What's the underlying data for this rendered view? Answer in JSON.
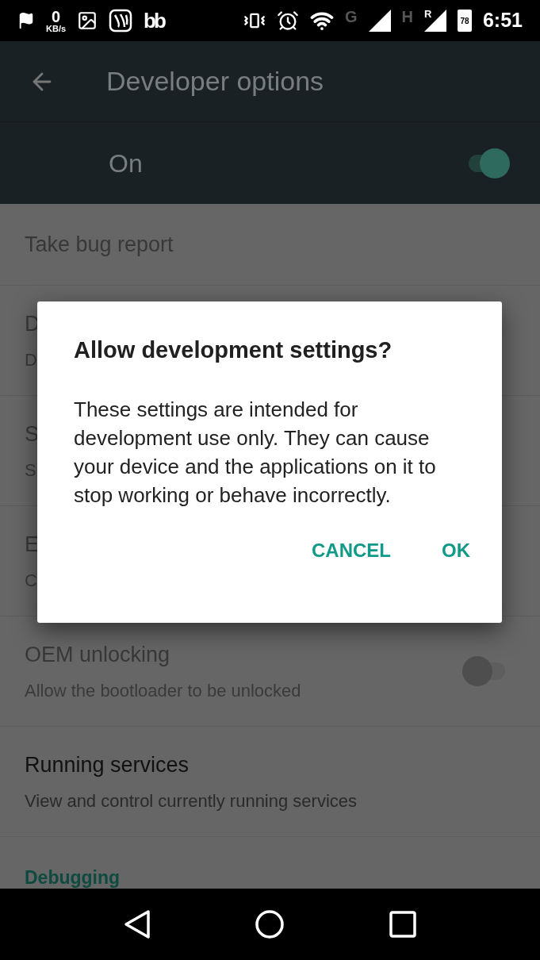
{
  "status_bar": {
    "net_speed": "0",
    "net_unit": "KB/s",
    "app_logo": "bb",
    "network_1": "G",
    "network_2": "H",
    "roaming": "R",
    "battery": "78",
    "time": "6:51"
  },
  "toolbar": {
    "title": "Developer options"
  },
  "master_switch": {
    "label": "On",
    "on": true
  },
  "rows": [
    {
      "title": "Take bug report",
      "disabled": true
    },
    {
      "title": "D",
      "subtitle": "D",
      "disabled": true
    },
    {
      "title": "S",
      "subtitle": "S",
      "disabled": true
    },
    {
      "title": "E",
      "subtitle": "C",
      "disabled": true
    },
    {
      "title": "OEM unlocking",
      "subtitle": "Allow the bootloader to be unlocked",
      "disabled": true,
      "toggle": {
        "on": false
      }
    },
    {
      "title": "Running services",
      "subtitle": "View and control currently running services",
      "disabled": false
    }
  ],
  "section_header": "Debugging",
  "dialog": {
    "title": "Allow development settings?",
    "message": "These settings are intended for development use only. They can cause your device and the applications on it to stop working or behave incorrectly.",
    "buttons": [
      "CANCEL",
      "OK"
    ]
  }
}
